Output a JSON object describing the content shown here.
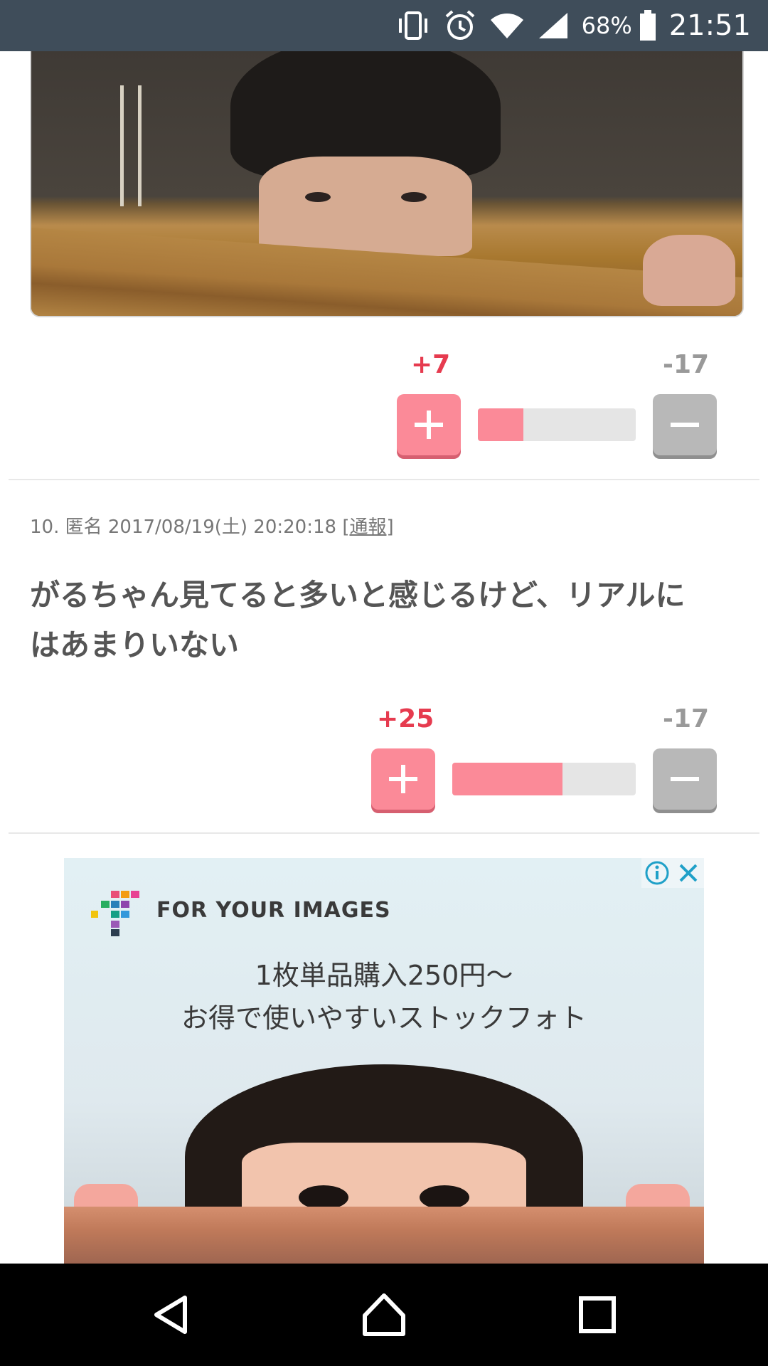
{
  "status_bar": {
    "battery_percent": "68%",
    "time": "21:51",
    "icons": [
      "vibrate-icon",
      "alarm-icon",
      "wifi-icon",
      "signal-icon",
      "battery-icon"
    ]
  },
  "posts": [
    {
      "votes": {
        "plus": "+7",
        "minus": "-17",
        "plus_ratio": 0.29
      }
    },
    {
      "meta_prefix": "10. 匿名 2017/08/19(土) 20:20:18 [",
      "report_label": "通報",
      "meta_suffix": "]",
      "text_line1": "がるちゃん見てると多いと感じるけど、リアルに",
      "text_line2": "はあまりいない",
      "votes": {
        "plus": "+25",
        "minus": "-17",
        "plus_ratio": 0.6
      }
    }
  ],
  "ad": {
    "brand": "FOR YOUR IMAGES",
    "line1": "1枚単品購入250円～",
    "line2": "お得で使いやすいストックフォト",
    "info_icon": "info-icon",
    "close_icon": "close-icon"
  },
  "nav": {
    "icons": [
      "back-icon",
      "home-icon",
      "recents-icon"
    ]
  },
  "colors": {
    "plus": "#fb8a98",
    "plus_text": "#e63b4f",
    "minus": "#b8b8b8",
    "status_bar": "#3f4d5a"
  }
}
